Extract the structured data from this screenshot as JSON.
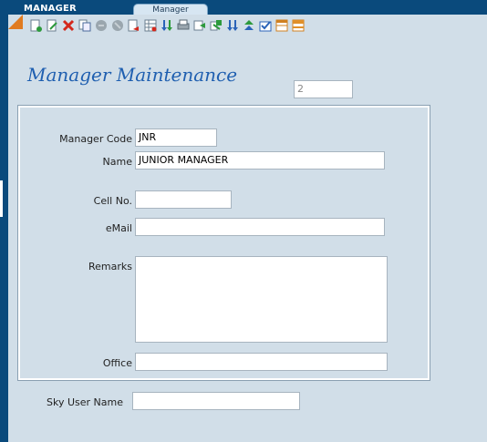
{
  "app": {
    "title": "MANAGER"
  },
  "tabs": [
    {
      "label": "Manager"
    }
  ],
  "toolbar": {
    "icons": [
      "new-record-icon",
      "edit-icon",
      "delete-icon",
      "copy-icon",
      "disabled-icon",
      "disabled-icon",
      "refresh-icon",
      "grid-icon",
      "import-icon",
      "print-icon",
      "export-icon",
      "transfer-icon",
      "download-icon",
      "upload-icon",
      "check-icon",
      "window-icon",
      "layout-icon"
    ]
  },
  "form": {
    "title": "Manager Maintenance",
    "record_number": "2",
    "fields": {
      "manager_code": {
        "label": "Manager Code",
        "value": "JNR"
      },
      "name": {
        "label": "Name",
        "value": "JUNIOR MANAGER"
      },
      "cell_no": {
        "label": "Cell No.",
        "value": ""
      },
      "email": {
        "label": "eMail",
        "value": ""
      },
      "remarks": {
        "label": "Remarks",
        "value": ""
      },
      "office": {
        "label": "Office",
        "value": ""
      },
      "sky_user_name": {
        "label": "Sky User Name",
        "value": ""
      }
    }
  },
  "colors": {
    "header_bg": "#0a4a7c",
    "content_bg": "#d1dee8",
    "title_blue": "#1f5fb0",
    "accent_orange": "#e07b20"
  }
}
